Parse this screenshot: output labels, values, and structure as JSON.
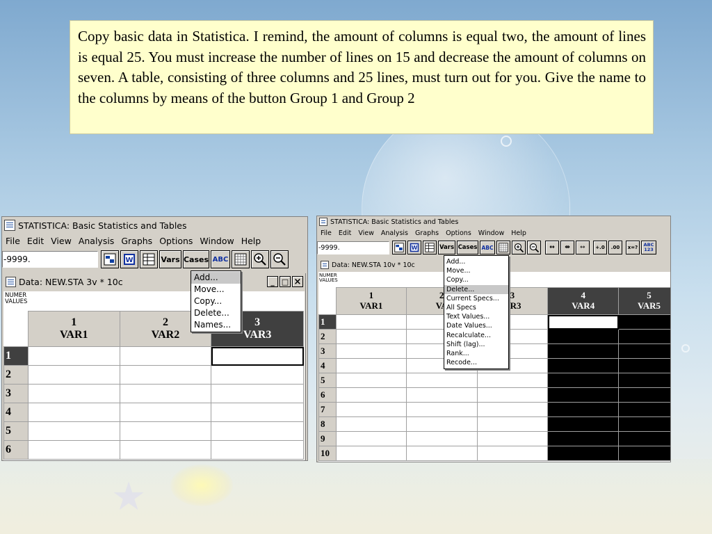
{
  "instruction": {
    "text": "Copy basic data in Statistica. I remind, the amount of columns is equal two, the amount of lines is equal 25. You must increase the number of lines on 15 and decrease the amount of columns on seven. A table, consisting of three columns and 25 lines, must turn out for you. Give the name to the columns by means of the button Group 1 and Group 2"
  },
  "left": {
    "title": "STATISTICA: Basic Statistics and Tables",
    "menus": [
      "File",
      "Edit",
      "View",
      "Analysis",
      "Graphs",
      "Options",
      "Window",
      "Help"
    ],
    "value_box": "-9999.",
    "toolbar": {
      "vars_label": "Vars",
      "cases_label": "Cases",
      "abc_label": "ABC"
    },
    "child_title": "Data: NEW.STA 3v * 10c",
    "window_buttons": {
      "minimize": "_",
      "restore": "□",
      "close": "×"
    },
    "header_corner": [
      "NUMER",
      "VALUES"
    ],
    "columns": [
      {
        "num": "1",
        "name": "VAR1"
      },
      {
        "num": "2",
        "name": "VAR2"
      },
      {
        "num": "3",
        "name": "VAR3"
      }
    ],
    "rows": [
      "1",
      "2",
      "3",
      "4",
      "5",
      "6"
    ],
    "context_menu": [
      "Add...",
      "Move...",
      "Copy...",
      "Delete...",
      "Names..."
    ]
  },
  "right": {
    "title": "STATISTICA: Basic Statistics and Tables",
    "menus": [
      "File",
      "Edit",
      "View",
      "Analysis",
      "Graphs",
      "Options",
      "Window",
      "Help"
    ],
    "value_box": "-9999.",
    "toolbar": {
      "vars_label": "Vars",
      "cases_label": "Cases",
      "abc_label": "ABC",
      "abc123_label": "ABC 123",
      "xeq_label": "x=?"
    },
    "child_title": "Data: NEW.STA 10v * 10c",
    "header_corner": [
      "NUMER",
      "VALUES"
    ],
    "columns": [
      {
        "num": "1",
        "name": "VAR1"
      },
      {
        "num": "2",
        "name": "VA"
      },
      {
        "num": "3",
        "name": "AR3"
      },
      {
        "num": "4",
        "name": "VAR4"
      },
      {
        "num": "5",
        "name": "VAR5"
      }
    ],
    "rows": [
      "1",
      "2",
      "3",
      "4",
      "5",
      "6",
      "7",
      "8",
      "9",
      "10"
    ],
    "context_menu": [
      "Add...",
      "Move...",
      "Copy...",
      "Delete...",
      "Current Specs...",
      "All Specs",
      "Text Values...",
      "Date Values...",
      "Recalculate...",
      "Shift (lag)...",
      "Rank...",
      "Recode..."
    ]
  }
}
